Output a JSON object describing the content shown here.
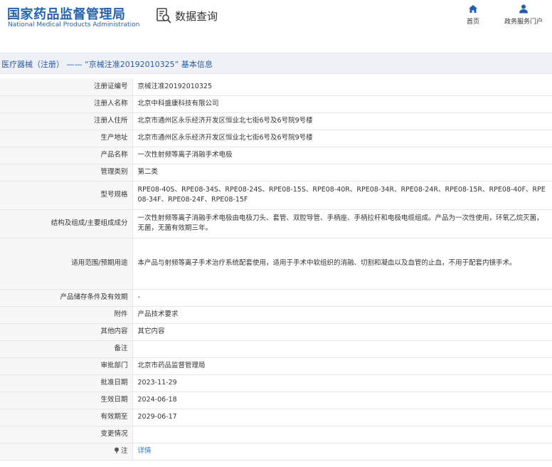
{
  "header": {
    "logo_cn": "国家药品监督管理局",
    "logo_en": "National Medical Products Administration",
    "search_title": "数据查询",
    "nav": {
      "home": "首页",
      "portal": "政务服务门户"
    }
  },
  "title_bar": "医疗器械（注册） ——  “京械注准20192010325” 基本信息",
  "rows": [
    {
      "label": "注册证编号",
      "value": "京械注准20192010325"
    },
    {
      "label": "注册人名称",
      "value": "北京中科盛康科技有限公司"
    },
    {
      "label": "注册人住所",
      "value": "北京市通州区永乐经济开发区恒业北七街6号及6号院9号楼"
    },
    {
      "label": "生产地址",
      "value": "北京市通州区永乐经济开发区恒业北七街6号及6号院9号楼"
    },
    {
      "label": "产品名称",
      "value": "一次性射频等离子消融手术电极"
    },
    {
      "label": "管理类别",
      "value": "第二类"
    },
    {
      "label": "型号规格",
      "value": "RPE08-40S、RPE08-34S、RPE08-24S、RPE08-15S、RPE08-40R、RPE08-34R、RPE08-24R、RPE08-15R、RPE08-40F、RPE08-34F、RPE08-24F、RPE08-15F"
    },
    {
      "label": "结构及组成/主要组成成分",
      "value": "一次性射频等离子消融手术电极由电极刀头、套管、双腔导管、手柄座、手柄拉杆和电极电缆组成。产品为一次性使用，环氧乙烷灭菌，无菌，无菌有效期三年。"
    },
    {
      "label": "适用范围/预期用途",
      "value": "本产品与射频等离子手术治疗系统配套使用，适用于手术中软组织的消融、切割和凝血以及血管的止血，不用于配套内镜手术。"
    },
    {
      "label": "产品储存条件及有效期",
      "value": "-"
    },
    {
      "label": "附件",
      "value": "产品技术要求"
    },
    {
      "label": "其他内容",
      "value": "其它内容"
    },
    {
      "label": "备注",
      "value": ""
    },
    {
      "label": "审批部门",
      "value": "北京市药品监督管理局"
    },
    {
      "label": "批准日期",
      "value": "2023-11-29"
    },
    {
      "label": "生效日期",
      "value": "2024-06-18"
    },
    {
      "label": "有效期至",
      "value": "2029-06-17"
    },
    {
      "label": "变更情况",
      "value": ""
    },
    {
      "label": "注",
      "value": "详情"
    }
  ],
  "icons": {
    "search": "document-search-icon",
    "home": "home-icon",
    "portal": "user-icon",
    "note": "pin-icon"
  },
  "colors": {
    "brand": "#2563b0",
    "link": "#2a6fc9",
    "title_bar_bg": "#eef1f6"
  }
}
